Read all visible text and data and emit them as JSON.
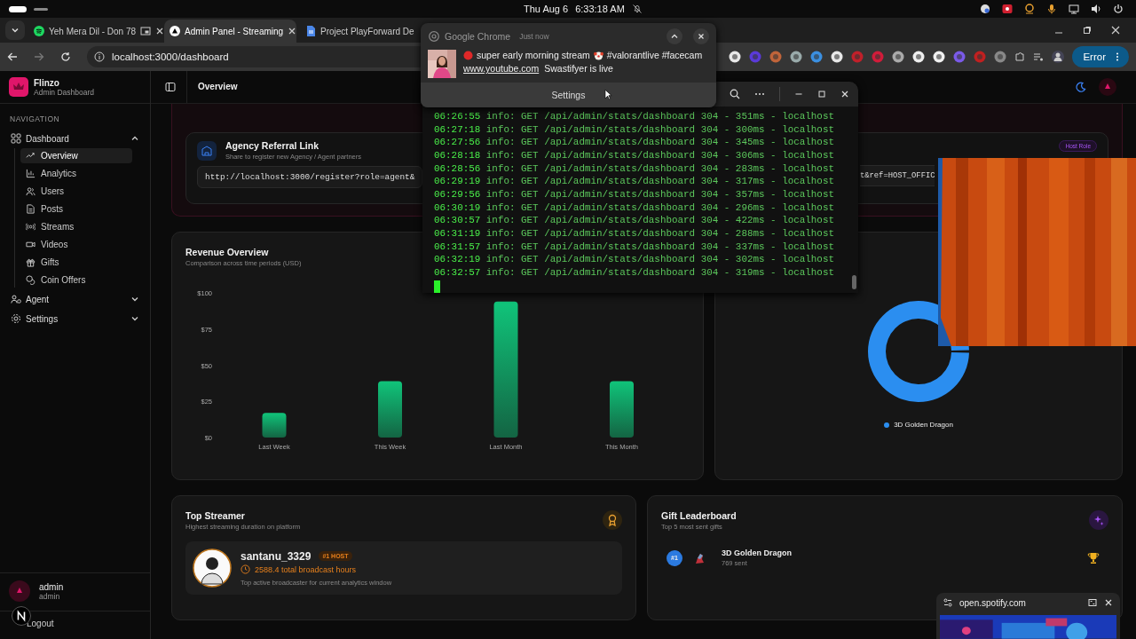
{
  "system_bar": {
    "date": "Thu Aug 6",
    "time": "6:33:18 AM"
  },
  "browser": {
    "tabs": [
      {
        "title": "Yeh Mera Dil - Don 78",
        "selected": false
      },
      {
        "title": "Admin Panel - Streaming",
        "selected": true
      },
      {
        "title": "Project PlayForward De",
        "selected": false
      }
    ],
    "address": "localhost:3000/dashboard",
    "profile_button": "Error"
  },
  "sidebar": {
    "brand": "Flinzo",
    "subtitle": "Admin Dashboard",
    "section": "NAVIGATION",
    "items": [
      {
        "label": "Dashboard",
        "expanded": true,
        "children": [
          {
            "label": "Overview",
            "selected": true
          },
          {
            "label": "Analytics",
            "selected": false
          },
          {
            "label": "Users",
            "selected": false
          },
          {
            "label": "Posts",
            "selected": false
          },
          {
            "label": "Streams",
            "selected": false
          },
          {
            "label": "Videos",
            "selected": false
          },
          {
            "label": "Gifts",
            "selected": false
          },
          {
            "label": "Coin Offers",
            "selected": false
          }
        ]
      },
      {
        "label": "Agent",
        "expanded": false
      },
      {
        "label": "Settings",
        "expanded": false
      }
    ],
    "user": {
      "name": "admin",
      "role": "admin"
    },
    "logout": "Logout"
  },
  "header": {
    "title": "Overview"
  },
  "referral": {
    "agency": {
      "title": "Agency Referral Link",
      "subtitle": "Share to register new Agency / Agent partners",
      "link": "http://localhost:3000/register?role=agent&"
    },
    "host": {
      "badge": "Host Role",
      "link": "t&ref=HOST_OFFIC"
    }
  },
  "revenue": {
    "title": "Revenue Overview",
    "subtitle": "Comparison across time periods (USD)",
    "chart_data": {
      "type": "bar",
      "categories": [
        "Last Week",
        "This Week",
        "Last Month",
        "This Month"
      ],
      "series": [
        {
          "color": "#10c47a",
          "values": [
            17,
            39,
            94,
            39
          ]
        }
      ],
      "ylim": [
        0,
        100
      ],
      "yticks": [
        {
          "value": 0,
          "label": "$0"
        },
        {
          "value": 25,
          "label": "$25"
        },
        {
          "value": 50,
          "label": "$50"
        },
        {
          "value": 75,
          "label": "$75"
        },
        {
          "value": 100,
          "label": "$100"
        }
      ]
    }
  },
  "gifts_distribution": {
    "legend": [
      "3D Golden Dragon"
    ]
  },
  "top_streamer": {
    "title": "Top Streamer",
    "subtitle": "Highest streaming duration on platform",
    "name": "santanu_3329",
    "badge": "#1 HOST",
    "hours": "2588.4 total broadcast hours",
    "note": "Top active broadcaster for current analytics window"
  },
  "gift_leaderboard": {
    "title": "Gift Leaderboard",
    "subtitle": "Top 5 most sent gifts",
    "entries": [
      {
        "rank": "#1",
        "name": "3D Golden Dragon",
        "count": "769 sent"
      }
    ]
  },
  "notification": {
    "app": "Google Chrome",
    "time": "Just now",
    "message_start": "super early morning stream",
    "message_end": "#valorantlive #facecam",
    "link": "www.youtube.com",
    "text": "Swastifyer is live",
    "action": "Settings"
  },
  "terminal": {
    "lines": [
      {
        "time": "06:26:55",
        "message": "info: GET /api/admin/stats/dashboard 304 - 351ms - localhost"
      },
      {
        "time": "06:27:18",
        "message": "info: GET /api/admin/stats/dashboard 304 - 300ms - localhost"
      },
      {
        "time": "06:27:56",
        "message": "info: GET /api/admin/stats/dashboard 304 - 345ms - localhost"
      },
      {
        "time": "06:28:18",
        "message": "info: GET /api/admin/stats/dashboard 304 - 306ms - localhost"
      },
      {
        "time": "06:28:56",
        "message": "info: GET /api/admin/stats/dashboard 304 - 283ms - localhost"
      },
      {
        "time": "06:29:19",
        "message": "info: GET /api/admin/stats/dashboard 304 - 317ms - localhost"
      },
      {
        "time": "06:29:56",
        "message": "info: GET /api/admin/stats/dashboard 304 - 357ms - localhost"
      },
      {
        "time": "06:30:19",
        "message": "info: GET /api/admin/stats/dashboard 304 - 296ms - localhost"
      },
      {
        "time": "06:30:57",
        "message": "info: GET /api/admin/stats/dashboard 304 - 422ms - localhost"
      },
      {
        "time": "06:31:19",
        "message": "info: GET /api/admin/stats/dashboard 304 - 288ms - localhost"
      },
      {
        "time": "06:31:57",
        "message": "info: GET /api/admin/stats/dashboard 304 - 337ms - localhost"
      },
      {
        "time": "06:32:19",
        "message": "info: GET /api/admin/stats/dashboard 304 - 302ms - localhost"
      },
      {
        "time": "06:32:57",
        "message": "info: GET /api/admin/stats/dashboard 304 - 319ms - localhost"
      }
    ]
  },
  "mini_player": {
    "site": "open.spotify.com"
  }
}
